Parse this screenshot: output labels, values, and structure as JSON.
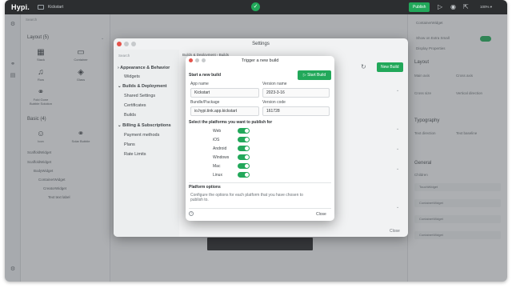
{
  "app": {
    "logo": "Hypi.",
    "project": "Kickstart",
    "publish_label": "Publish",
    "zoom": "100% ▾"
  },
  "left_panel": {
    "search": "Search",
    "layout_header": "Layout (5)",
    "components": [
      "Stack",
      "Container",
      "Row",
      "Glass",
      "Fold Gone Bubble Solution"
    ],
    "basic_header": "Basic (4)",
    "basic_components": [
      "Icon",
      "Solar Bubble"
    ],
    "tree_header": "ScaffoldWidget",
    "tree": [
      "ScaffoldWidget",
      "BodyWidget",
      "ContainerWidget",
      "CreatorWidget",
      "Text text label"
    ]
  },
  "right_panel": {
    "title": "ContainerWidget",
    "show_label": "Show on Extra Small",
    "display_props": "Display Properties",
    "layout_header": "Layout",
    "typography_header": "Typography",
    "general_header": "General",
    "layout_fields": [
      "Main axis",
      "Cross axis",
      "Cross size",
      "Vertical direction"
    ],
    "typography_fields": [
      "Text direction",
      "Text baseline"
    ],
    "general_label": "Children",
    "general_rows": [
      "TouchWidget",
      "ContainerWidget",
      "ContainerWidget",
      "ContainerWidget"
    ]
  },
  "settings": {
    "title": "Settings",
    "search": "Search",
    "breadcrumb": "Builds & Deployment › Builds",
    "new_build": "New Build",
    "close": "Close",
    "groups": [
      {
        "label": "Appearance & Behavior",
        "items": [
          "Widgets"
        ]
      },
      {
        "label": "Builds & Deployment",
        "items": [
          "Shared Settings",
          "Certificates",
          "Builds"
        ]
      },
      {
        "label": "Billing & Subscriptions",
        "items": [
          "Payment methods",
          "Plans",
          "Rate Limits"
        ]
      }
    ]
  },
  "trigger": {
    "title": "Trigger a new build",
    "section_start": "Start a new build",
    "start_button": "Start Build",
    "app_name_label": "App name",
    "app_name_value": "Kickstart",
    "version_name_label": "Version name",
    "version_name_value": "2023-3-16",
    "bundle_label": "Bundle/Package",
    "bundle_value": "io.hypi.tink.app.kickstart",
    "version_code_label": "Version code",
    "version_code_value": "161728",
    "platforms_label": "Select the platforms you want to publish for",
    "platforms": [
      {
        "name": "Web",
        "enabled": true
      },
      {
        "name": "iOS",
        "enabled": true
      },
      {
        "name": "Android",
        "enabled": true
      },
      {
        "name": "Windows",
        "enabled": true
      },
      {
        "name": "Mac",
        "enabled": true
      },
      {
        "name": "Linux",
        "enabled": true
      }
    ],
    "options_label": "Platform options",
    "options_desc": "Configure the options for each platform that you have chosen to publish to.",
    "close": "Close",
    "help": "?"
  },
  "colors": {
    "accent": "#22a85a",
    "topbar": "#2c2e30"
  }
}
